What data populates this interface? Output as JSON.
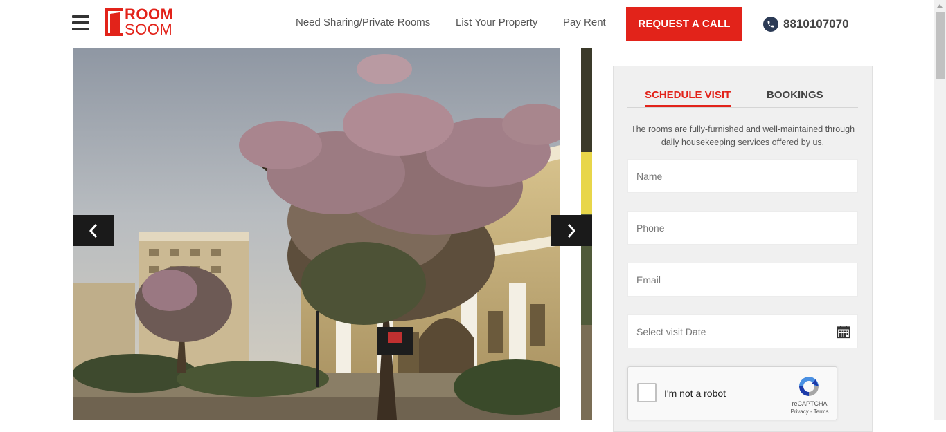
{
  "header": {
    "logo": {
      "line1": "ROOM",
      "line2": "SOOM"
    },
    "nav": [
      {
        "label": "Need Sharing/Private Rooms"
      },
      {
        "label": "List Your Property"
      },
      {
        "label": "Pay Rent"
      }
    ],
    "cta_label": "REQUEST A CALL",
    "phone": "8810107070",
    "icons": [
      "hamburger-menu-icon",
      "phone-icon"
    ]
  },
  "gallery": {
    "prev_icon": "chevron-left-icon",
    "next_icon": "chevron-right-icon"
  },
  "form": {
    "tabs": [
      {
        "label": "SCHEDULE VISIT",
        "active": true
      },
      {
        "label": "BOOKINGS",
        "active": false
      }
    ],
    "description": "The rooms are fully-furnished and well-maintained through daily housekeeping services offered by us.",
    "fields": {
      "name": {
        "placeholder": "Name",
        "value": ""
      },
      "phone": {
        "placeholder": "Phone",
        "value": ""
      },
      "email": {
        "placeholder": "Email",
        "value": ""
      },
      "date": {
        "placeholder": "Select visit Date",
        "value": "",
        "icon": "calendar-icon"
      }
    },
    "captcha": {
      "label": "I'm not a robot",
      "brand": "reCAPTCHA",
      "privacy": "Privacy",
      "separator": " - ",
      "terms": "Terms"
    }
  },
  "colors": {
    "brand_red": "#e2231a",
    "dark": "#1a1a1a",
    "panel_bg": "#f0f0f0",
    "phone_icon_bg": "#2b3a55"
  }
}
